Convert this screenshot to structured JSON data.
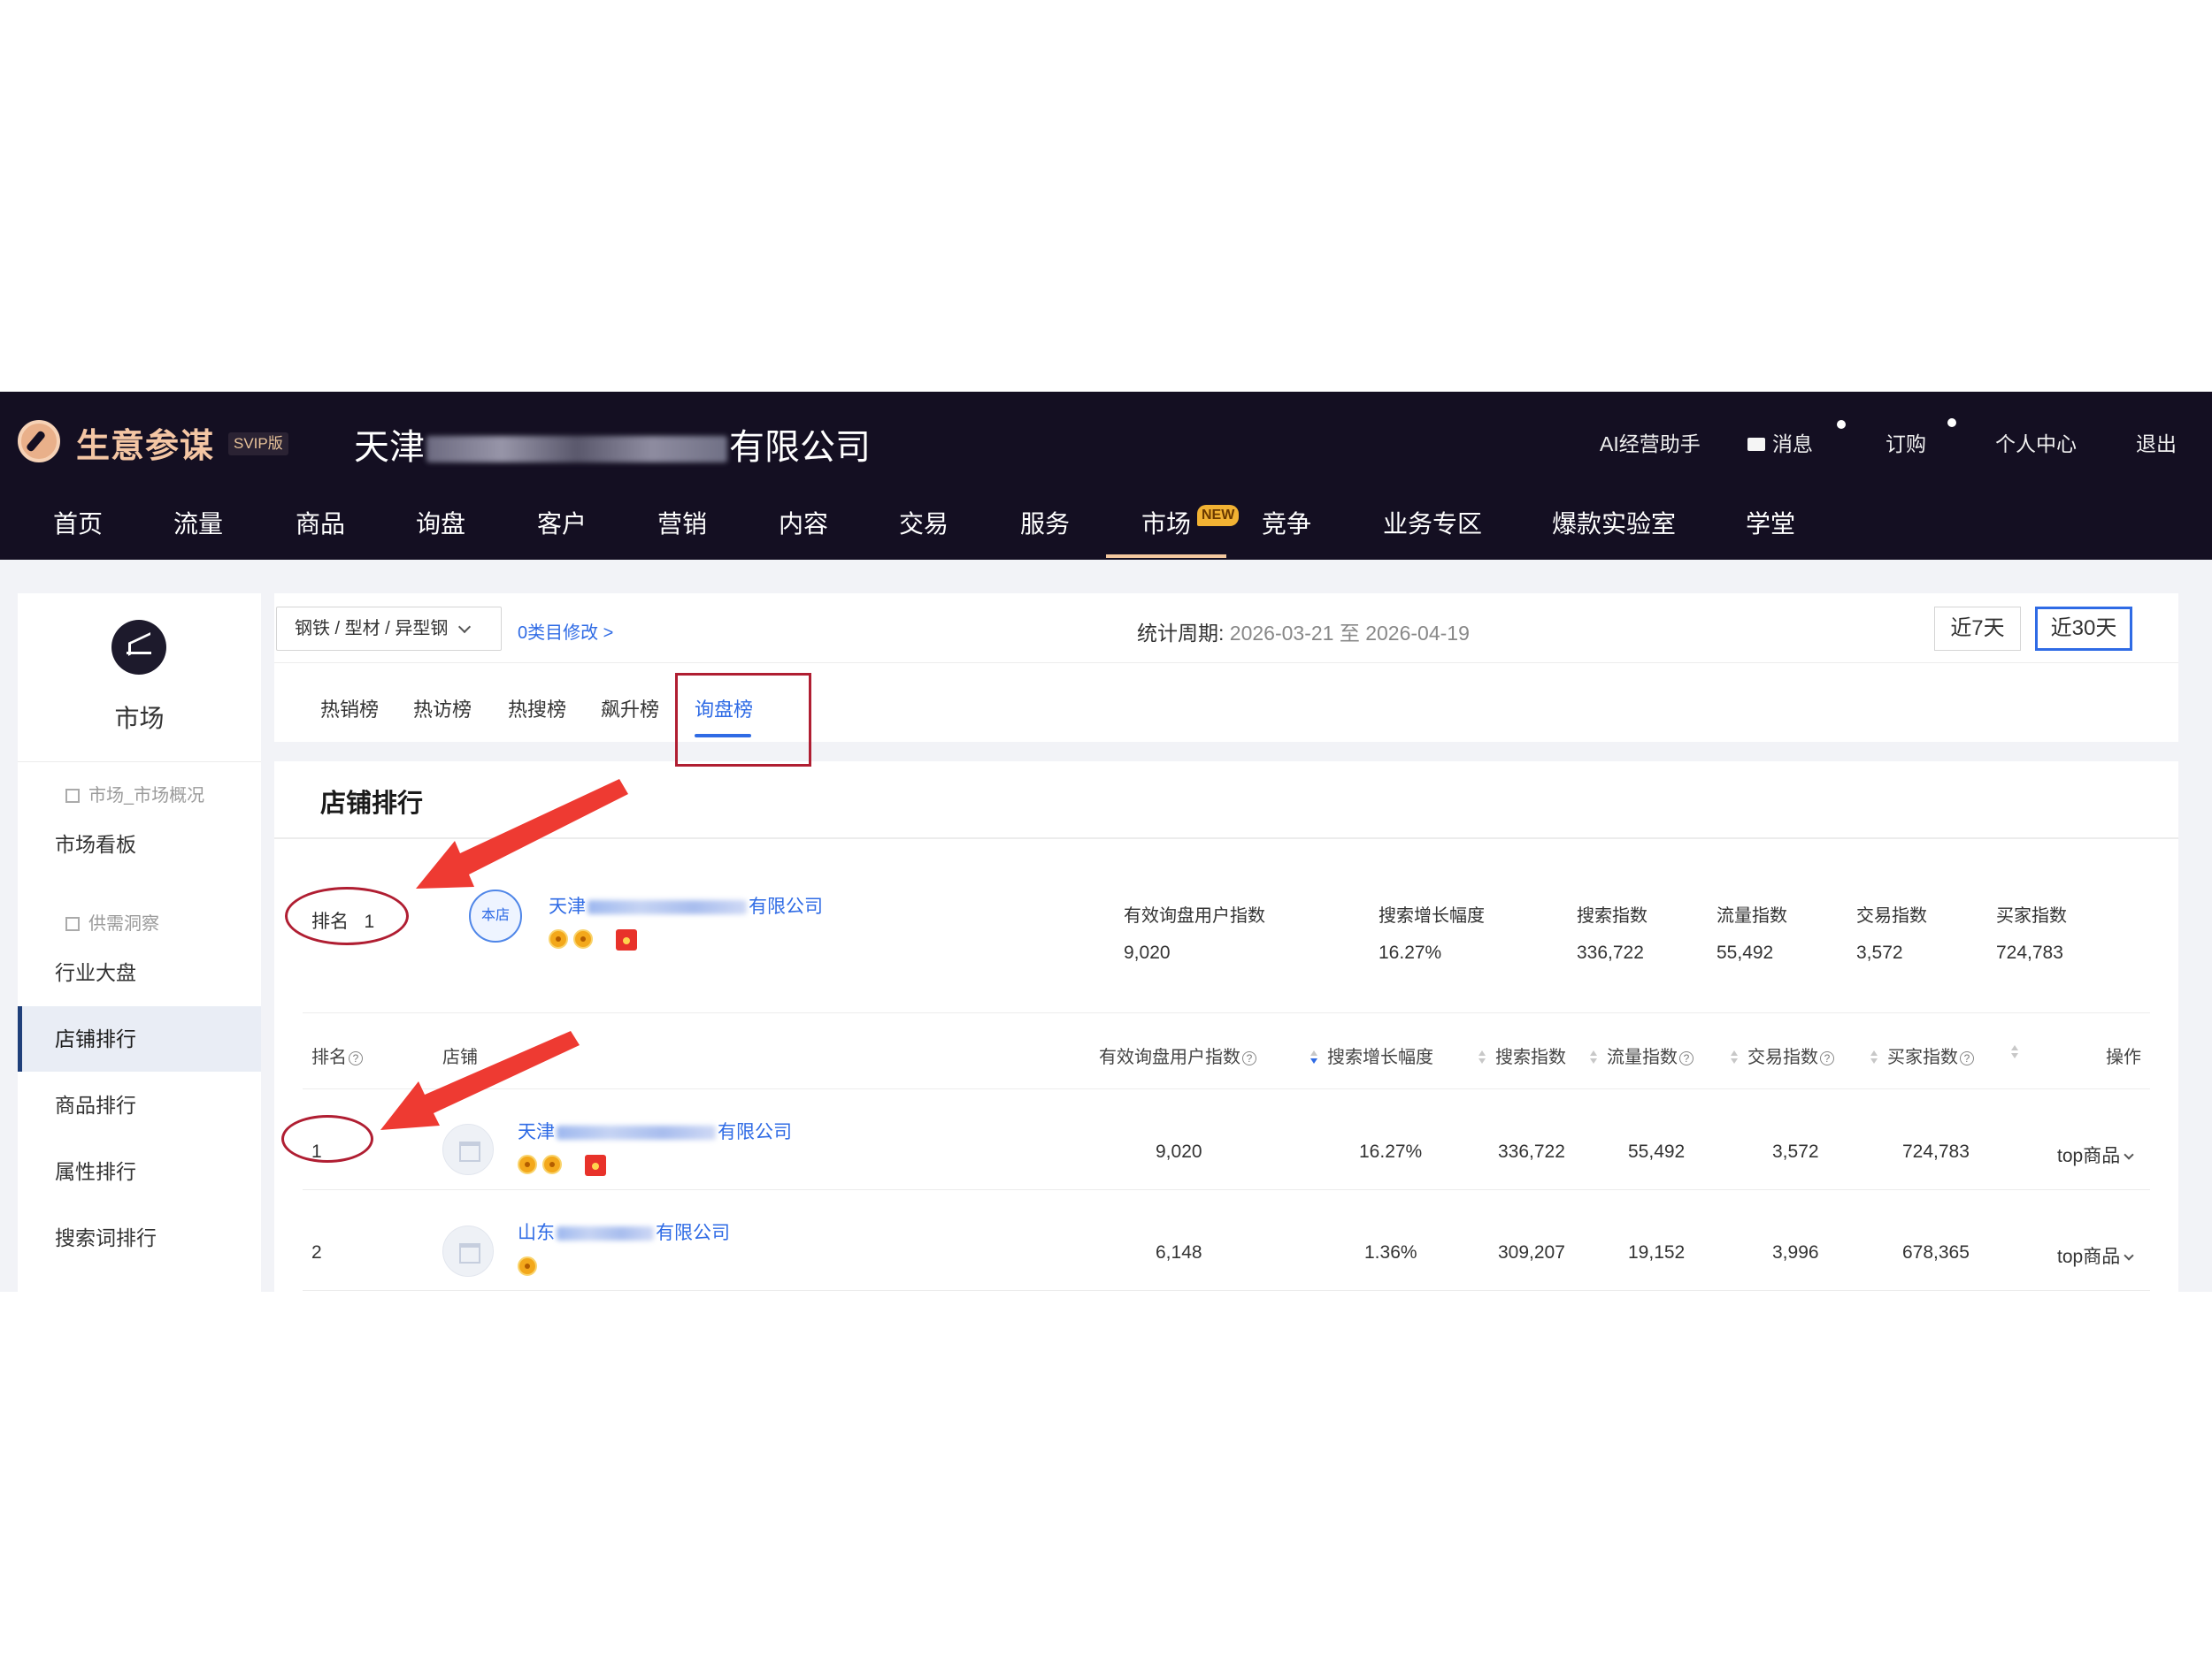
{
  "header": {
    "brand": "生意参谋",
    "edition": "SVIP版",
    "company_prefix": "天津",
    "company_suffix": "有限公司",
    "utils": {
      "ai": "AI经营助手",
      "messages": "消息",
      "orders": "订购",
      "personal": "个人中心",
      "logout": "退出"
    },
    "nav": [
      "首页",
      "流量",
      "商品",
      "询盘",
      "客户",
      "营销",
      "内容",
      "交易",
      "服务",
      "市场",
      "竞争",
      "业务专区",
      "爆款实验室",
      "学堂"
    ],
    "nav_new_badge": "NEW",
    "active_nav": "市场",
    "colors": {
      "bar": "#140f22",
      "brand": "#f4c6a4",
      "accent": "#2f6be5",
      "annotation": "#b01e32"
    }
  },
  "sidebar": {
    "title": "市场",
    "group1": "市场_市场概况",
    "item_board": "市场看板",
    "group2": "供需洞察",
    "item_industry": "行业大盘",
    "item_shop_rank": "店铺排行",
    "item_goods_rank": "商品排行",
    "item_attr_rank": "属性排行",
    "item_keyword_rank": "搜索词排行"
  },
  "filter": {
    "category": "钢铁 / 型材 / 异型钢",
    "category_edit": "0类目修改 >",
    "period_label": "统计周期:",
    "period_value": "2026-03-21 至 2026-04-19",
    "range_7": "近7天",
    "range_30": "近30天",
    "active_range": "近30天",
    "tabs": [
      "热销榜",
      "热访榜",
      "热搜榜",
      "飙升榜",
      "询盘榜"
    ],
    "active_tab": "询盘榜"
  },
  "ranking": {
    "title": "店铺排行",
    "mine": {
      "rank_label": "排名",
      "rank": "1",
      "badge": "本店",
      "shop_prefix": "天津",
      "shop_suffix": "有限公司",
      "metric_heads": [
        "有效询盘用户指数",
        "搜索增长幅度",
        "搜索指数",
        "流量指数",
        "交易指数",
        "买家指数"
      ],
      "metric_values": [
        "9,020",
        "16.27%",
        "336,722",
        "55,492",
        "3,572",
        "724,783"
      ]
    },
    "columns": {
      "rank": "排名",
      "shop": "店铺",
      "inquiry": "有效询盘用户指数",
      "growth": "搜索增长幅度",
      "search": "搜索指数",
      "traffic": "流量指数",
      "trade": "交易指数",
      "buyer": "买家指数",
      "op": "操作"
    },
    "rows": [
      {
        "rank": "1",
        "shop_prefix": "天津",
        "shop_suffix": "有限公司",
        "inquiry": "9,020",
        "growth": "16.27%",
        "search": "336,722",
        "traffic": "55,492",
        "trade": "3,572",
        "buyer": "724,783",
        "op": "top商品"
      },
      {
        "rank": "2",
        "shop_prefix": "山东",
        "shop_suffix": "有限公司",
        "inquiry": "6,148",
        "growth": "1.36%",
        "search": "309,207",
        "traffic": "19,152",
        "trade": "3,996",
        "buyer": "678,365",
        "op": "top商品"
      }
    ]
  }
}
